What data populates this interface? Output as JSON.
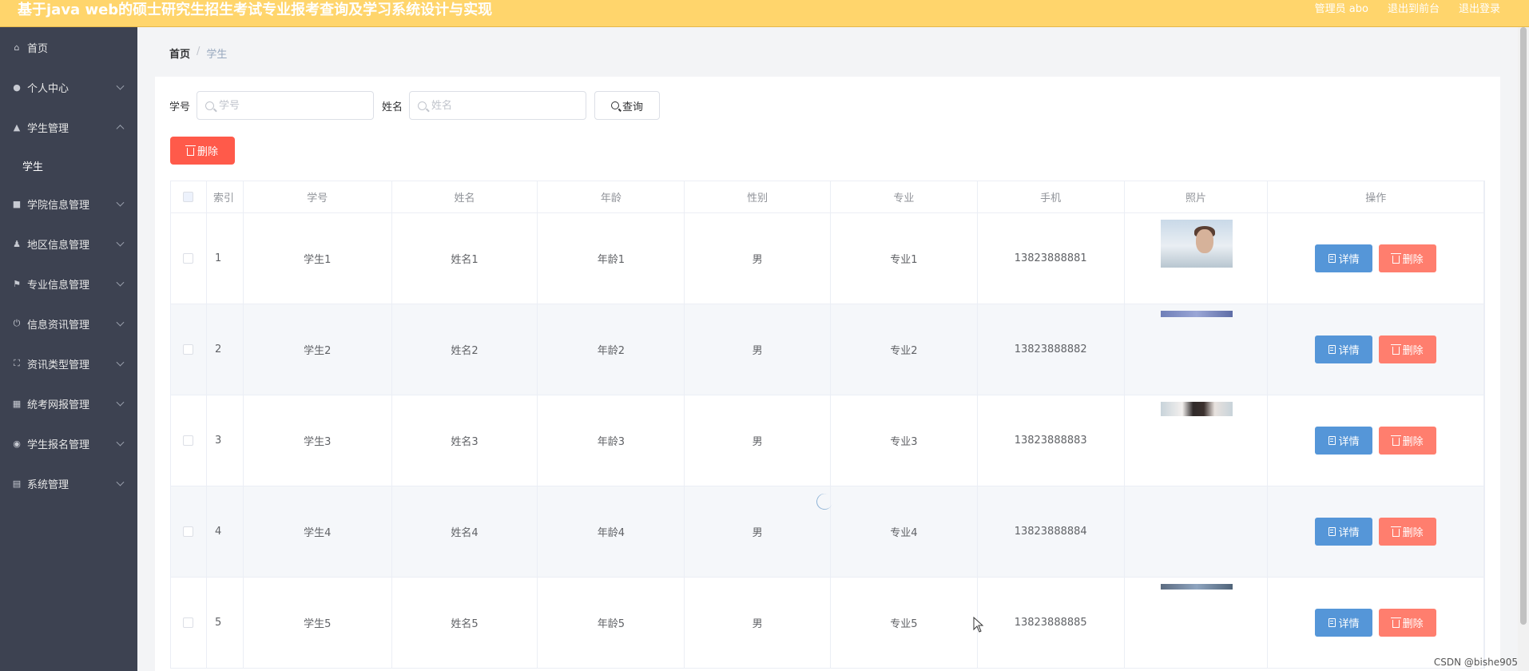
{
  "header": {
    "title": "基于java web的硕士研究生招生考试专业报考查询及学习系统设计与实现",
    "admin_label": "管理员 abo",
    "back_label": "退出到前台",
    "logout_label": "退出登录",
    "color": "#ffd56c"
  },
  "sidebar": {
    "items": [
      {
        "label": "首页",
        "icon": "home-icon"
      },
      {
        "label": "个人中心",
        "icon": "user-icon"
      },
      {
        "label": "学生管理",
        "icon": "bank-icon"
      },
      {
        "label": "学院信息管理",
        "icon": "chat-icon"
      },
      {
        "label": "地区信息管理",
        "icon": "person-icon"
      },
      {
        "label": "专业信息管理",
        "icon": "flag-icon"
      },
      {
        "label": "信息资讯管理",
        "icon": "power-icon"
      },
      {
        "label": "资讯类型管理",
        "icon": "fullscreen-icon"
      },
      {
        "label": "统考网报管理",
        "icon": "grid-icon"
      },
      {
        "label": "学生报名管理",
        "icon": "location-icon"
      },
      {
        "label": "系统管理",
        "icon": "clipboard-icon"
      }
    ],
    "sub_item": "学生"
  },
  "breadcrumb": {
    "home": "首页",
    "sep": "/",
    "current": "学生"
  },
  "search": {
    "id_label": "学号",
    "id_placeholder": "学号",
    "name_label": "姓名",
    "name_placeholder": "姓名",
    "query_label": "查询"
  },
  "delete_label": "删除",
  "table": {
    "headers": [
      "索引",
      "学号",
      "姓名",
      "年龄",
      "性别",
      "专业",
      "手机",
      "照片",
      "操作"
    ],
    "rows": [
      {
        "index": "1",
        "id": "学生1",
        "name": "姓名1",
        "age": "年龄1",
        "gender": "男",
        "major": "专业1",
        "phone": "13823888881"
      },
      {
        "index": "2",
        "id": "学生2",
        "name": "姓名2",
        "age": "年龄2",
        "gender": "男",
        "major": "专业2",
        "phone": "13823888882"
      },
      {
        "index": "3",
        "id": "学生3",
        "name": "姓名3",
        "age": "年龄3",
        "gender": "男",
        "major": "专业3",
        "phone": "13823888883"
      },
      {
        "index": "4",
        "id": "学生4",
        "name": "姓名4",
        "age": "年龄4",
        "gender": "男",
        "major": "专业4",
        "phone": "13823888884"
      },
      {
        "index": "5",
        "id": "学生5",
        "name": "姓名5",
        "age": "年龄5",
        "gender": "男",
        "major": "专业5",
        "phone": "13823888885"
      }
    ],
    "detail_label": "详情",
    "delete_label": "删除"
  },
  "watermark": "CSDN @bishe905"
}
